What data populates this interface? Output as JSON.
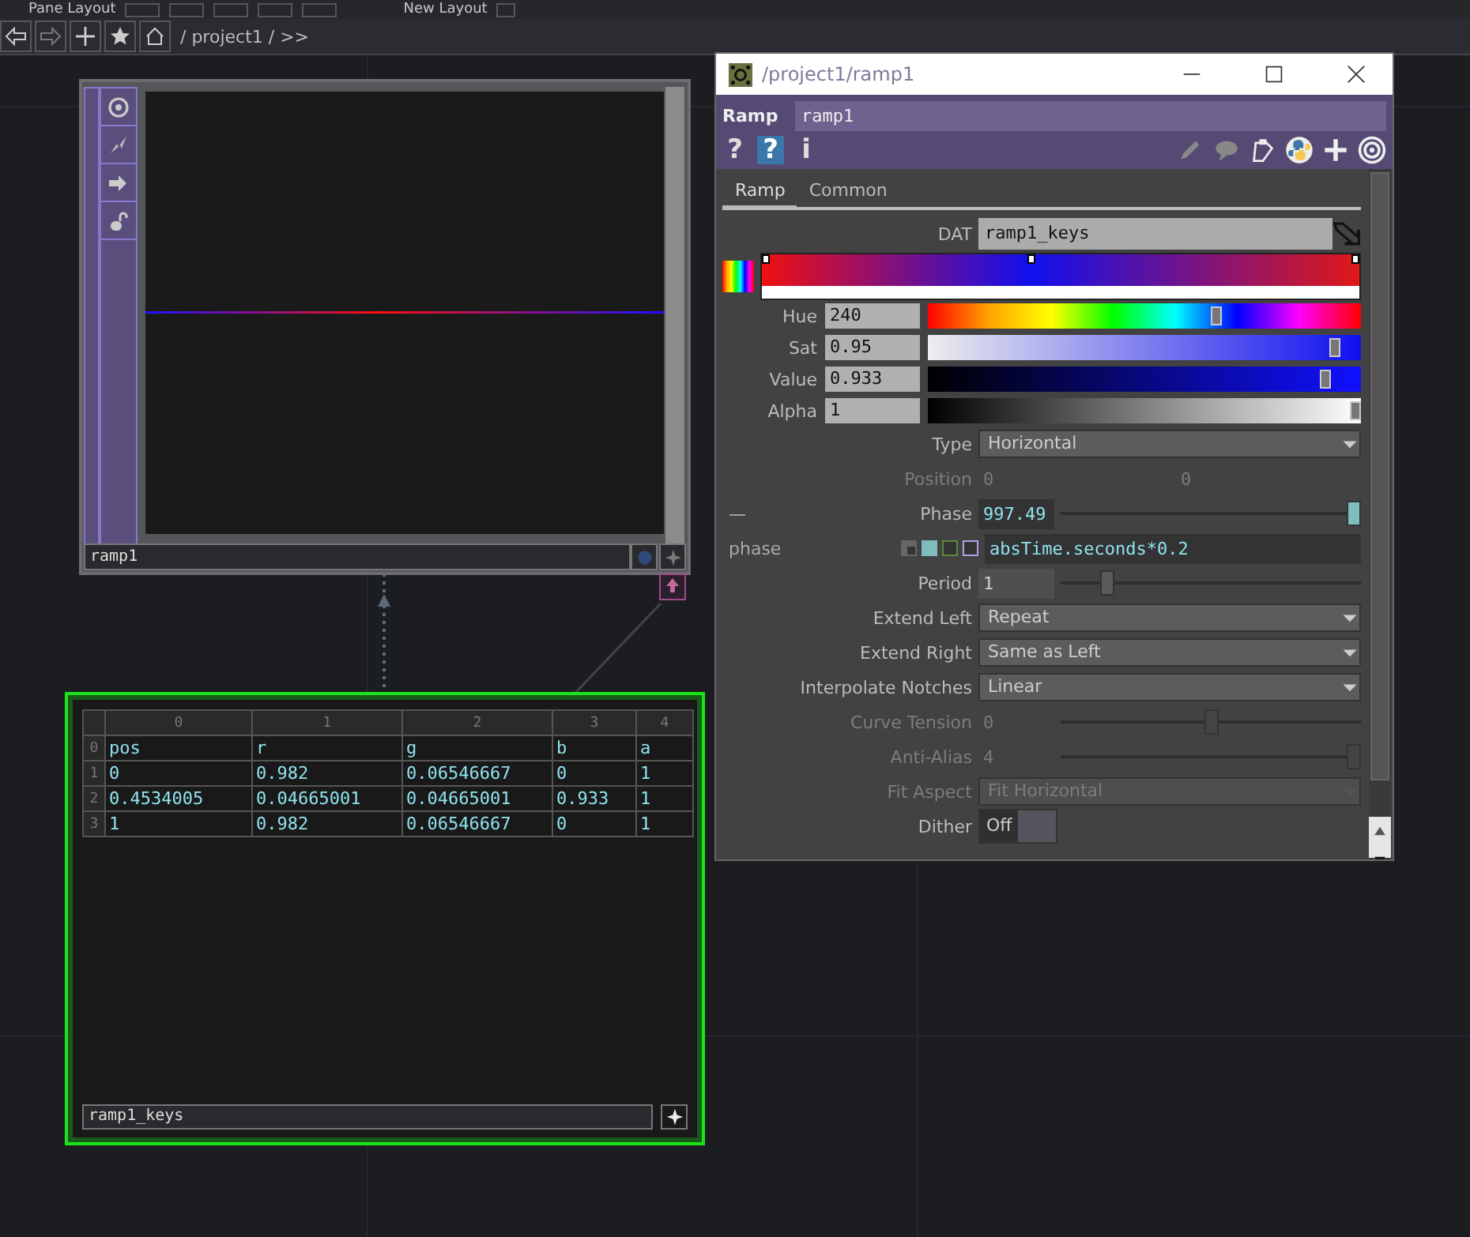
{
  "pane_bar": {
    "pane_layout_label": "Pane Layout",
    "new_layout_label": "New Layout"
  },
  "path_bar": {
    "path": "/ project1 / >>"
  },
  "ramp_node": {
    "name": "ramp1",
    "selected": false
  },
  "keys_node": {
    "name": "ramp1_keys",
    "selected": true,
    "table": {
      "columns": [
        "0",
        "1",
        "2",
        "3",
        "4"
      ],
      "rows": [
        {
          "index": "0",
          "cells": [
            "pos",
            "r",
            "g",
            "b",
            "a"
          ]
        },
        {
          "index": "1",
          "cells": [
            "0",
            "0.982",
            "0.06546667",
            "0",
            "1"
          ]
        },
        {
          "index": "2",
          "cells": [
            "0.4534005",
            "0.04665001",
            "0.04665001",
            "0.933",
            "1"
          ]
        },
        {
          "index": "3",
          "cells": [
            "1",
            "0.982",
            "0.06546667",
            "0",
            "1"
          ]
        }
      ]
    }
  },
  "param_window": {
    "title": "/project1/ramp1",
    "op_type": "Ramp",
    "op_name": "ramp1",
    "help_buttons": [
      {
        "kind": "plain",
        "label": "?"
      },
      {
        "kind": "python",
        "label": "?"
      },
      {
        "kind": "plain",
        "label": "i"
      }
    ],
    "tabs": [
      {
        "label": "Ramp",
        "selected": true
      },
      {
        "label": "Common",
        "selected": false
      }
    ],
    "dat": {
      "label": "DAT",
      "value": "ramp1_keys"
    },
    "color_params": [
      {
        "kind": "hue",
        "label": "Hue",
        "value": "240",
        "level": 0.67
      },
      {
        "kind": "sat",
        "label": "Sat",
        "value": "0.95",
        "level": 0.95
      },
      {
        "kind": "value",
        "label": "Value",
        "value": "0.933",
        "level": 0.93
      },
      {
        "kind": "alpha",
        "label": "Alpha",
        "value": "1",
        "level": 1
      }
    ],
    "params": [
      {
        "kind": "menu",
        "label": "Type",
        "value": "Horizontal",
        "disabled": false
      },
      {
        "kind": "xy",
        "label": "Position",
        "values": [
          "0",
          "0"
        ],
        "disabled": true
      },
      {
        "kind": "float",
        "label": "Phase",
        "value": "997.49",
        "level": 1,
        "disabled": false,
        "expanded": true,
        "collapse_icon": "—",
        "expression": {
          "label": "phase",
          "text": "absTime.seconds*0.2"
        }
      },
      {
        "kind": "float",
        "label": "Period",
        "value": "1",
        "level": 0.14,
        "disabled": false
      },
      {
        "kind": "menu",
        "label": "Extend Left",
        "value": "Repeat",
        "disabled": false
      },
      {
        "kind": "menu",
        "label": "Extend Right",
        "value": "Same as Left",
        "disabled": false
      },
      {
        "kind": "menu",
        "label": "Interpolate Notches",
        "value": "Linear",
        "disabled": false
      },
      {
        "kind": "float",
        "label": "Curve Tension",
        "value": "0",
        "level": 0.5,
        "disabled": true
      },
      {
        "kind": "float",
        "label": "Anti-Alias",
        "value": "4",
        "level": 1,
        "disabled": true
      },
      {
        "kind": "menu",
        "label": "Fit Aspect",
        "value": "Fit Horizontal",
        "disabled": true
      },
      {
        "kind": "toggle",
        "label": "Dither",
        "value": "Off",
        "on": false,
        "disabled": false
      }
    ]
  }
}
